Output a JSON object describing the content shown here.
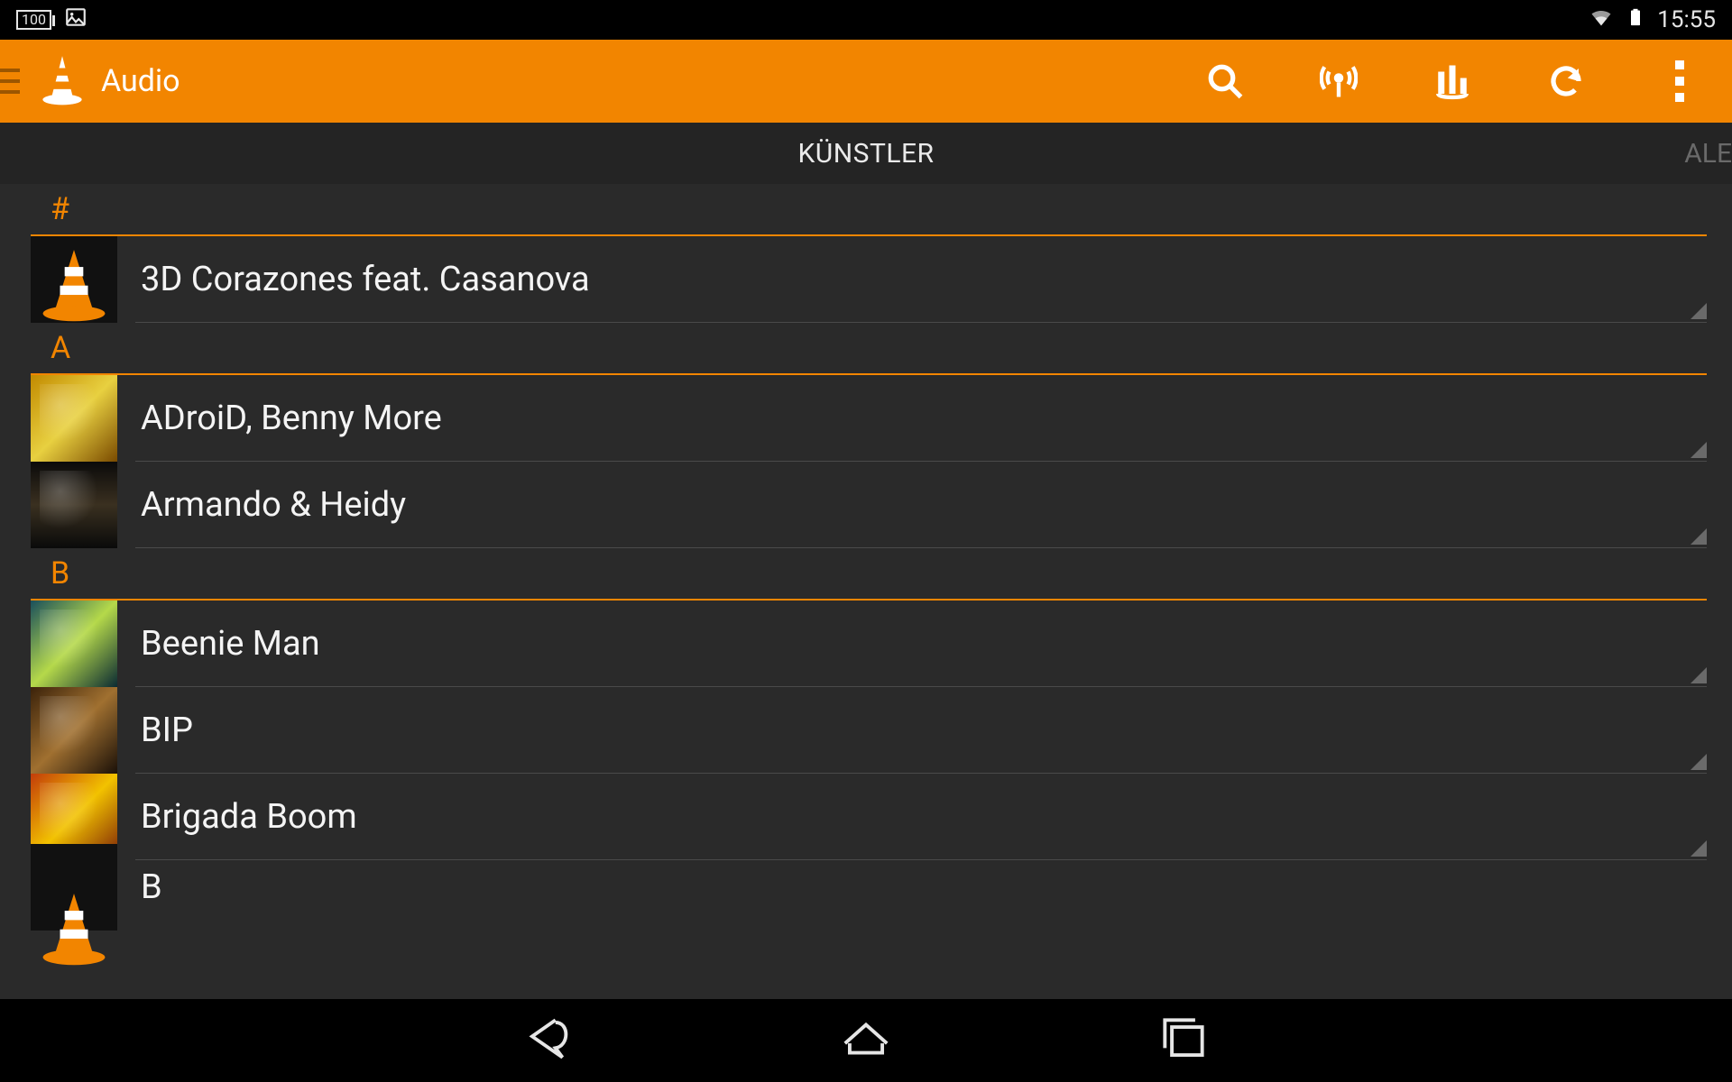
{
  "status": {
    "battery_text": "100",
    "time": "15:55"
  },
  "appbar": {
    "title": "Audio"
  },
  "tabs": {
    "center": "KÜNSTLER",
    "right_peek": "ALE"
  },
  "sections": [
    {
      "letter": "#",
      "items": [
        {
          "label": "3D Corazones feat. Casanova",
          "thumb": "cone"
        }
      ]
    },
    {
      "letter": "A",
      "items": [
        {
          "label": "ADroiD, Benny More",
          "thumb": "a1"
        },
        {
          "label": "Armando & Heidy",
          "thumb": "a2"
        }
      ]
    },
    {
      "letter": "B",
      "items": [
        {
          "label": "Beenie Man",
          "thumb": "b1"
        },
        {
          "label": "BIP",
          "thumb": "b2"
        },
        {
          "label": "Brigada Boom",
          "thumb": "b3"
        }
      ]
    }
  ],
  "partial_item_label": "B"
}
